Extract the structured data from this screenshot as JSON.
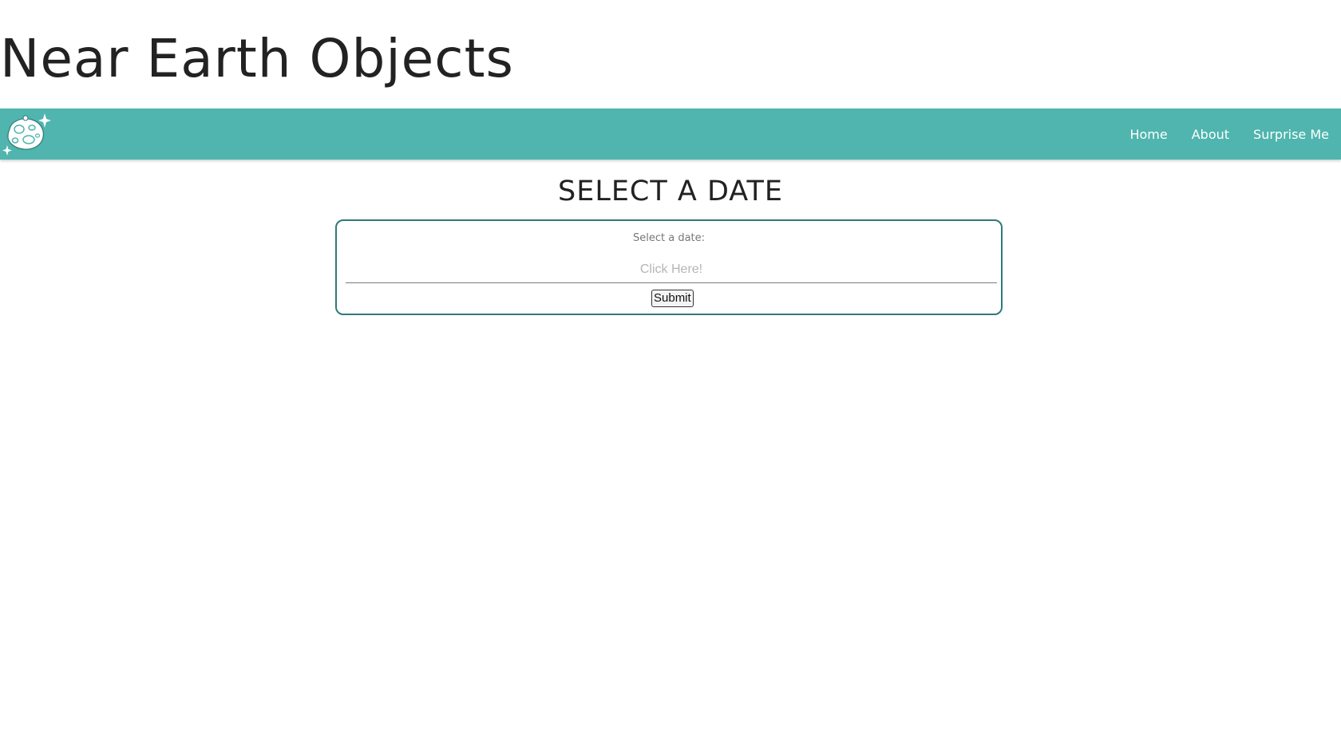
{
  "header": {
    "title": "Near Earth Objects"
  },
  "navbar": {
    "logo_icon": "asteroid-icon",
    "background_color": "#4fb5ae",
    "links": [
      {
        "label": "Home"
      },
      {
        "label": "About"
      },
      {
        "label": "Surprise Me"
      }
    ]
  },
  "main": {
    "heading": "SELECT A DATE",
    "form": {
      "label": "Select a date:",
      "date_input": {
        "value": "",
        "placeholder": "Click Here!"
      },
      "submit_label": "Submit",
      "border_color": "#2f7a78"
    }
  }
}
